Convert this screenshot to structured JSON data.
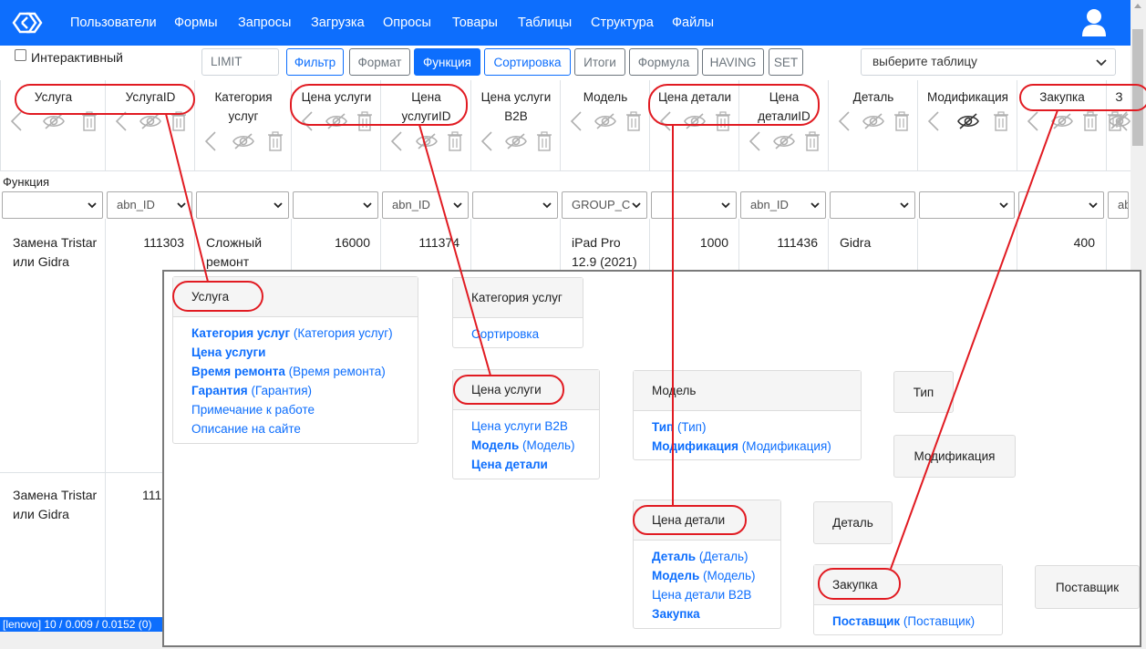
{
  "nav": {
    "items": [
      "Пользователи",
      "Формы",
      "Запросы",
      "Загрузка",
      "Опросы",
      "Товары",
      "Таблицы",
      "Структура",
      "Файлы"
    ],
    "brand_color": "#0d6efd"
  },
  "toolbar": {
    "interactive_label": "Интерактивный",
    "limit_placeholder": "LIMIT",
    "buttons": [
      "Фильтр",
      "Формат",
      "Функция",
      "Сортировка",
      "Итоги",
      "Формула",
      "HAVING",
      "SET"
    ],
    "active_button": "Функция",
    "table_select": "выберите таблицу"
  },
  "grid": {
    "headers": [
      "Услуга",
      "УслугаID",
      "Категория услуг",
      "Цена услуги",
      "Цена услугиID",
      "Цена услуги B2B",
      "Модель",
      "Цена детали",
      "Цена деталиID",
      "Деталь",
      "Модификация",
      "Закупка",
      "З"
    ],
    "function_label": "Функция",
    "function_selects": [
      "",
      "abn_ID",
      "",
      "",
      "abn_ID",
      "",
      "GROUP_C",
      "",
      "abn_ID",
      "",
      "",
      "",
      "ab"
    ],
    "row1": {
      "service": "Замена Tristar или Gidra",
      "service_id": "111303",
      "category": "Сложный ремонт",
      "price": "16000",
      "price_id": "111374",
      "model": "iPad Pro 12.9 (2021)",
      "part_price": "1000",
      "part_price_id": "111436",
      "part": "Gidra",
      "purchase": "400"
    },
    "row2": {
      "service": "Замена Tristar или Gidra",
      "service_id": "111"
    }
  },
  "status_bar": "[lenovo] 10 / 0.009 / 0.0152 (0)",
  "overlay": {
    "usluga": {
      "title": "Услуга",
      "links": [
        {
          "bold": "Категория услуг",
          "rest": " (Категория услуг)"
        },
        {
          "bold": "Цена услуги",
          "rest": ""
        },
        {
          "bold": "Время ремонта",
          "rest": " (Время ремонта)"
        },
        {
          "bold": "Гарантия",
          "rest": " (Гарантия)"
        },
        {
          "bold": "",
          "rest": "Примечание к работе"
        },
        {
          "bold": "",
          "rest": "Описание на сайте"
        }
      ]
    },
    "kategoria": {
      "title": "Категория услуг",
      "links": [
        "Сортировка"
      ]
    },
    "tsena_uslugi": {
      "title": "Цена услуги",
      "links": [
        {
          "bold": "",
          "rest": "Цена услуги B2B"
        },
        {
          "bold": "Модель",
          "rest": " (Модель)"
        },
        {
          "bold": "Цена детали",
          "rest": ""
        }
      ]
    },
    "model": {
      "title": "Модель",
      "links": [
        {
          "bold": "Тип",
          "rest": " (Тип)"
        },
        {
          "bold": "Модификация",
          "rest": " (Модификация)"
        }
      ]
    },
    "tsena_detali": {
      "title": "Цена детали",
      "links": [
        {
          "bold": "Деталь",
          "rest": " (Деталь)"
        },
        {
          "bold": "Модель",
          "rest": " (Модель)"
        },
        {
          "bold": "",
          "rest": "Цена детали B2B"
        },
        {
          "bold": "Закупка",
          "rest": ""
        }
      ]
    },
    "zakupka": {
      "title": "Закупка",
      "links": [
        {
          "bold": "Поставщик",
          "rest": " (Поставщик)"
        }
      ]
    },
    "standalone": {
      "tip": "Тип",
      "modifikatsia": "Модификация",
      "detal": "Деталь",
      "postavshik": "Поставщик"
    }
  },
  "annotation_color": "#e11b22"
}
